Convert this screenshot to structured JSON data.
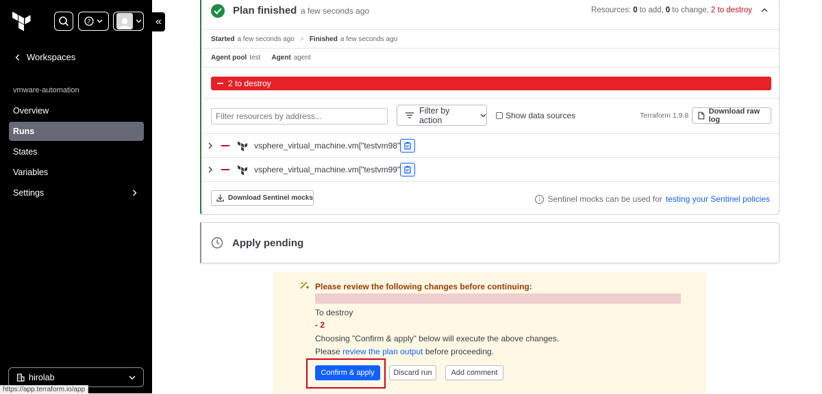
{
  "sidebar": {
    "back_label": "Workspaces",
    "workspace_name": "vmware-automation",
    "nav": [
      {
        "label": "Overview",
        "active": false
      },
      {
        "label": "Runs",
        "active": true
      },
      {
        "label": "States",
        "active": false
      },
      {
        "label": "Variables",
        "active": false
      },
      {
        "label": "Settings",
        "active": false
      }
    ],
    "org_name": "hirolab",
    "collapse_glyph": "«"
  },
  "status_bar_url": "https://app.terraform.io/app",
  "plan": {
    "title": "Plan finished",
    "time": "a few seconds ago",
    "summary_prefix": "Resources:",
    "add_count": "0",
    "add_label": "to add,",
    "change_count": "0",
    "change_label": "to change,",
    "destroy_text": "2 to destroy",
    "started_label": "Started",
    "started_time": "a few seconds ago",
    "sep": ">",
    "finished_label": "Finished",
    "finished_time": "a few seconds ago",
    "agent_pool_label": "Agent pool",
    "agent_pool_value": "test",
    "agent_label": "Agent",
    "agent_value": "agent",
    "destroy_bar": "2 to destroy",
    "filter_placeholder": "Filter resources by address...",
    "filter_action": "Filter by action",
    "show_data_sources": "Show data sources",
    "tf_version": "Terraform 1.9.8",
    "download_raw_log": "Download raw log",
    "resources": [
      {
        "address": "vsphere_virtual_machine.vm[\"testvm98\"]"
      },
      {
        "address": "vsphere_virtual_machine.vm[\"testvm99\"]"
      }
    ],
    "download_sentinel": "Download Sentinel mocks",
    "sentinel_note": "Sentinel mocks can be used for",
    "sentinel_link": "testing your Sentinel policies"
  },
  "apply": {
    "title": "Apply pending"
  },
  "review": {
    "heading": "Please review the following changes before continuing:",
    "to_destroy_label": "To destroy",
    "destroy_count": "- 2",
    "line1": "Choosing \"Confirm & apply\" below will execute the above changes.",
    "line2_prefix": "Please",
    "line2_link": "review the plan output",
    "line2_suffix": "before proceeding.",
    "confirm_label": "Confirm & apply",
    "discard_label": "Discard run",
    "comment_label": "Add comment"
  },
  "colors": {
    "accent": "#1060ff",
    "destroy": "#e52228",
    "success": "#1e8a45",
    "highlight": "#d1001f"
  }
}
